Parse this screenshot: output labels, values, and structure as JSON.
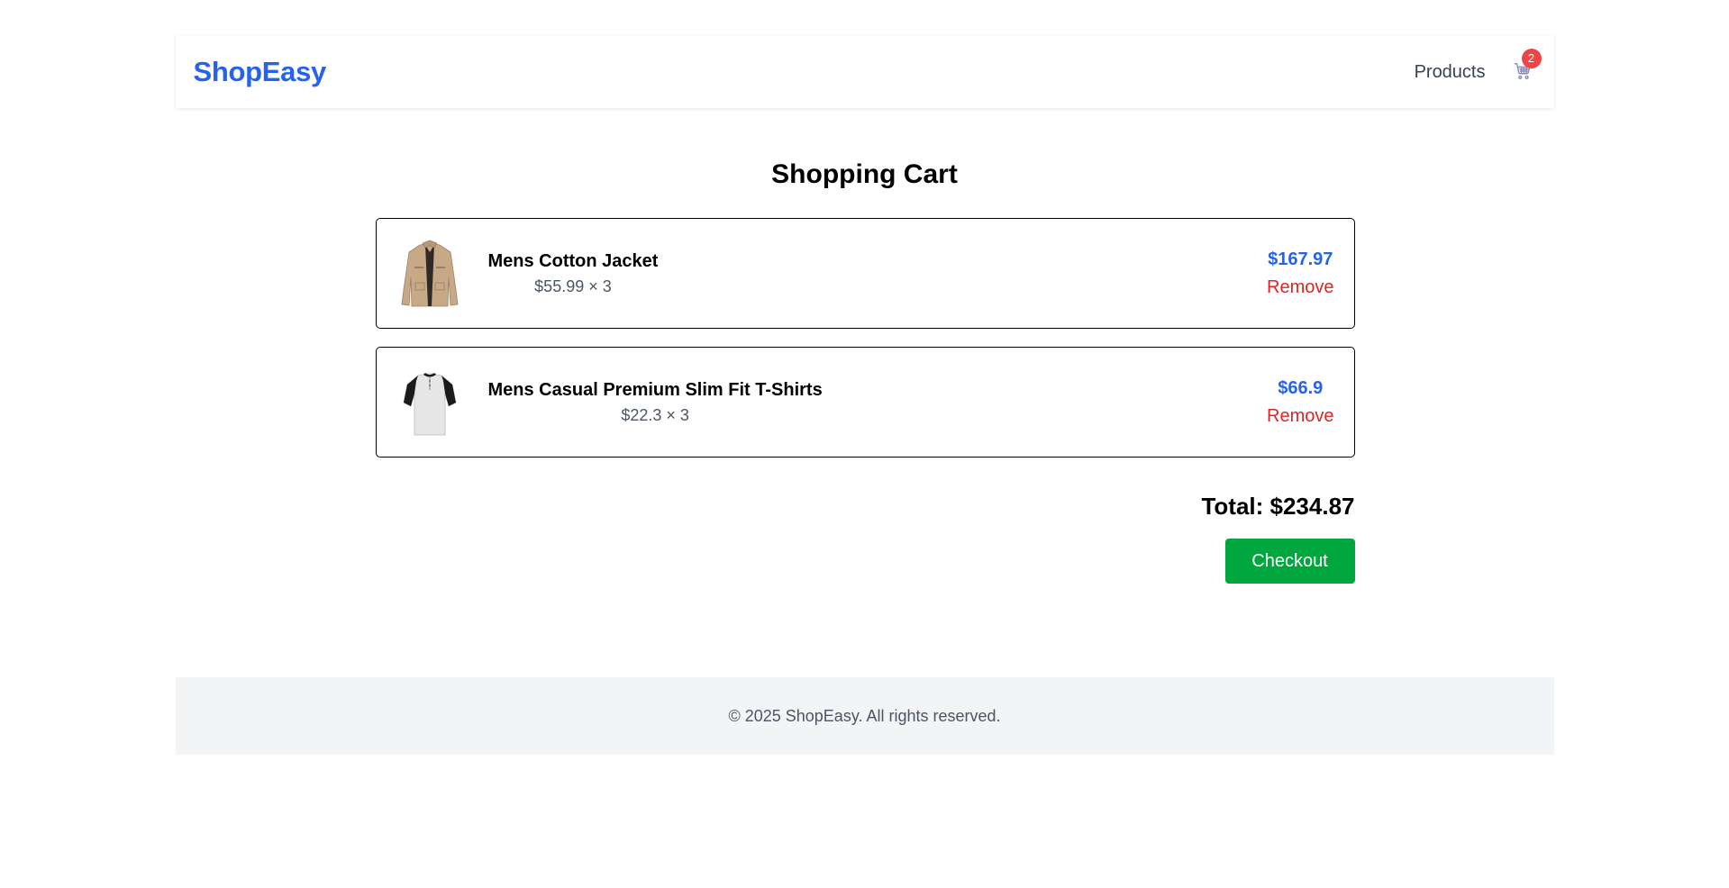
{
  "nav": {
    "brand": "ShopEasy",
    "links": [
      {
        "label": "Products"
      }
    ],
    "cart_icon": "cart-icon",
    "cart_count": "2"
  },
  "cart": {
    "title": "Shopping Cart",
    "items": [
      {
        "name": "Mens Cotton Jacket",
        "unit_qty": "$55.99 × 3",
        "line_total": "$167.97",
        "remove_label": "Remove",
        "image_icon": "jacket-image"
      },
      {
        "name": "Mens Casual Premium Slim Fit T-Shirts",
        "unit_qty": "$22.3 × 3",
        "line_total": "$66.9",
        "remove_label": "Remove",
        "image_icon": "tshirt-image"
      }
    ],
    "total": "Total: $234.87",
    "checkout_label": "Checkout"
  },
  "footer": {
    "text": "© 2025 ShopEasy. All rights reserved."
  },
  "colors": {
    "brand": "#2563eb",
    "price": "#2563eb",
    "remove": "#dc2626",
    "checkout": "#00a63e",
    "badge": "#ef4444",
    "footer_bg": "#f3f4f6"
  }
}
